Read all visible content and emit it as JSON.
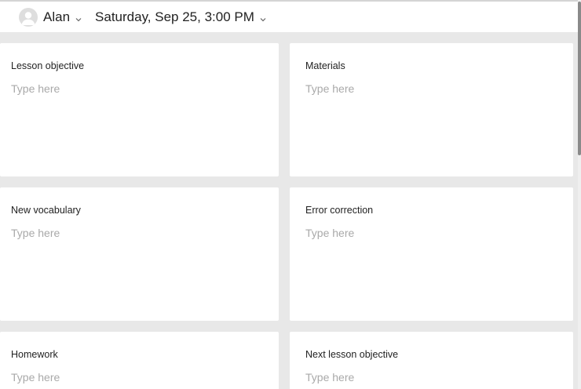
{
  "header": {
    "user_name": "Alan",
    "datetime": "Saturday, Sep 25, 3:00 PM",
    "user_icon": "user-avatar-icon",
    "dropdown_icon": "chevron-down-icon"
  },
  "cards": [
    {
      "title": "Lesson objective",
      "placeholder": "Type here"
    },
    {
      "title": "Materials",
      "placeholder": "Type here"
    },
    {
      "title": "New vocabulary",
      "placeholder": "Type here"
    },
    {
      "title": "Error correction",
      "placeholder": "Type here"
    },
    {
      "title": "Homework",
      "placeholder": "Type here"
    },
    {
      "title": "Next lesson objective",
      "placeholder": "Type here"
    }
  ],
  "colors": {
    "background": "#e8e8e8",
    "card": "#ffffff",
    "placeholder": "#a9a9a9",
    "text": "#222222"
  }
}
